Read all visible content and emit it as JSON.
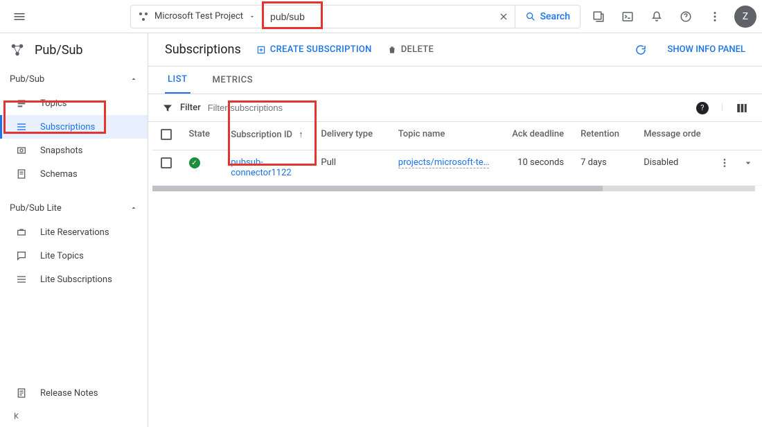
{
  "topbar": {
    "project_name": "Microsoft Test Project",
    "search_value": "pub/sub",
    "search_button": "Search",
    "avatar_letter": "Z"
  },
  "sidebar": {
    "service_name": "Pub/Sub",
    "section1_title": "Pub/Sub",
    "section1_items": [
      "Topics",
      "Subscriptions",
      "Snapshots",
      "Schemas"
    ],
    "section2_title": "Pub/Sub Lite",
    "section2_items": [
      "Lite Reservations",
      "Lite Topics",
      "Lite Subscriptions"
    ],
    "release_notes": "Release Notes"
  },
  "page": {
    "title": "Subscriptions",
    "create_label": "CREATE SUBSCRIPTION",
    "delete_label": "DELETE",
    "info_panel": "SHOW INFO PANEL",
    "tabs": [
      "LIST",
      "METRICS"
    ]
  },
  "filter": {
    "label": "Filter",
    "placeholder": "Filter subscriptions"
  },
  "table": {
    "headers": {
      "state": "State",
      "sub_id": "Subscription ID",
      "delivery": "Delivery type",
      "topic": "Topic name",
      "ack": "Ack deadline",
      "retention": "Retention",
      "order": "Message orde"
    },
    "row": {
      "sub_id": "pubsub-connector1122",
      "delivery": "Pull",
      "topic": "projects/microsoft-te…",
      "ack": "10 seconds",
      "retention": "7 days",
      "order": "Disabled"
    }
  }
}
